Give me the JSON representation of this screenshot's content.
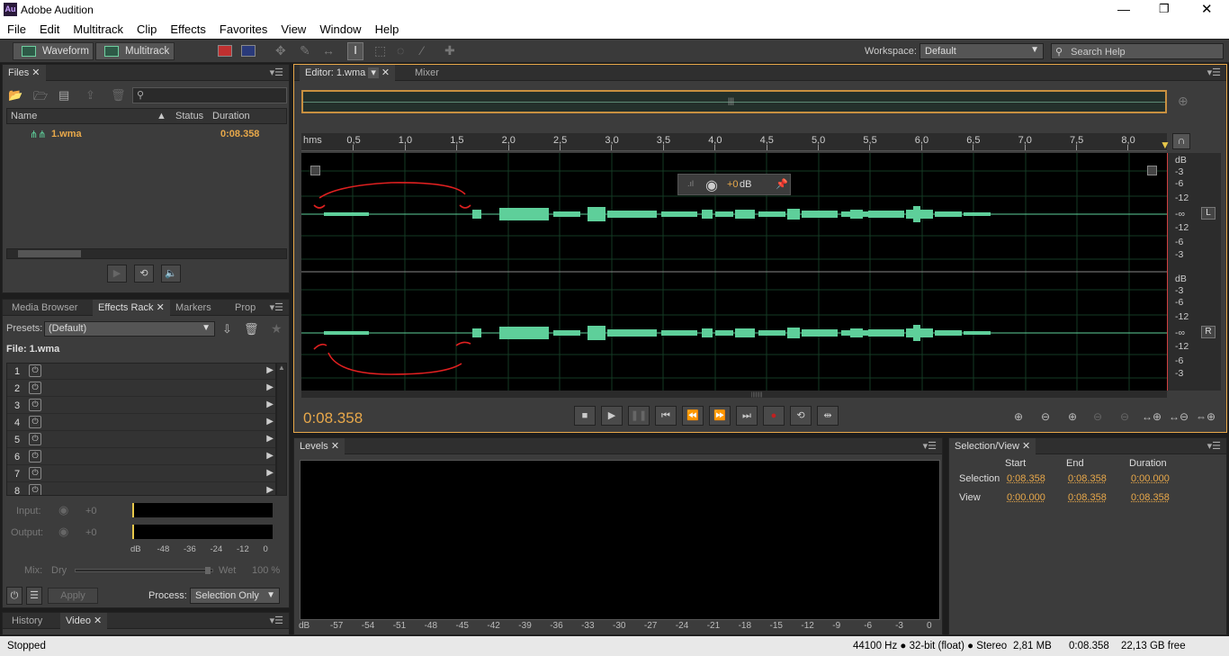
{
  "app": {
    "title": "Adobe Audition",
    "icon_text": "Au"
  },
  "menu": [
    "File",
    "Edit",
    "Multitrack",
    "Clip",
    "Effects",
    "Favorites",
    "View",
    "Window",
    "Help"
  ],
  "toolbar": {
    "waveform": "Waveform",
    "multitrack": "Multitrack",
    "workspace_label": "Workspace:",
    "workspace_value": "Default",
    "search_placeholder": "Search Help"
  },
  "files": {
    "tab": "Files",
    "col_name": "Name",
    "col_status": "Status",
    "col_duration": "Duration",
    "items": [
      {
        "name": "1.wma",
        "duration": "0:08.358"
      }
    ]
  },
  "lower_tabs": [
    "Media Browser",
    "Effects Rack",
    "Markers",
    "Prop"
  ],
  "effects": {
    "presets_label": "Presets:",
    "presets_value": "(Default)",
    "file_label": "File: 1.wma",
    "slots": [
      "1",
      "2",
      "3",
      "4",
      "5",
      "6",
      "7",
      "8"
    ],
    "input_label": "Input:",
    "output_label": "Output:",
    "input_val": "+0",
    "output_val": "+0",
    "mix_label": "Mix:",
    "dry": "Dry",
    "wet": "Wet",
    "wet_pct": "100 %",
    "apply": "Apply",
    "process_label": "Process:",
    "process_value": "Selection Only",
    "meter_ticks": [
      "dB",
      "-48",
      "-36",
      "-24",
      "-12",
      "0"
    ]
  },
  "bottom_tabs": [
    "History",
    "Video"
  ],
  "editor": {
    "tab": "Editor: 1.wma",
    "mixer": "Mixer",
    "ruler_unit": "hms",
    "ruler": [
      "0,5",
      "1,0",
      "1,5",
      "2,0",
      "2,5",
      "3,0",
      "3,5",
      "4,0",
      "4,5",
      "5,0",
      "5,5",
      "6,0",
      "6,5",
      "7,0",
      "7,5",
      "8,0"
    ],
    "db_top": [
      "dB",
      "-3",
      "-6",
      "-12",
      "-∞",
      "-12",
      "-6",
      "-3"
    ],
    "db_bottom": [
      "dB",
      "-3",
      "-6",
      "-12",
      "-∞",
      "-12",
      "-6",
      "-3"
    ],
    "chan_l": "L",
    "chan_r": "R",
    "hud_gain": "+0",
    "hud_unit": "dB",
    "time": "0:08.358"
  },
  "levels": {
    "tab": "Levels",
    "ticks": [
      "dB",
      "-57",
      "-54",
      "-51",
      "-48",
      "-45",
      "-42",
      "-39",
      "-36",
      "-33",
      "-30",
      "-27",
      "-24",
      "-21",
      "-18",
      "-15",
      "-12",
      "-9",
      "-6",
      "-3",
      "0"
    ]
  },
  "selection": {
    "tab": "Selection/View",
    "hdr_start": "Start",
    "hdr_end": "End",
    "hdr_duration": "Duration",
    "sel_label": "Selection",
    "view_label": "View",
    "sel_start": "0:08.358",
    "sel_end": "0:08.358",
    "sel_dur": "0:00.000",
    "view_start": "0:00.000",
    "view_end": "0:08.358",
    "view_dur": "0:08.358"
  },
  "status": {
    "state": "Stopped",
    "format": "44100 Hz ● 32-bit (float) ● Stereo",
    "size": "2,81 MB",
    "duration": "0:08.358",
    "free": "22,13 GB free"
  },
  "colors": {
    "accent": "#e8a84a",
    "wave": "#5ecf9a",
    "annotation": "#e02020"
  }
}
